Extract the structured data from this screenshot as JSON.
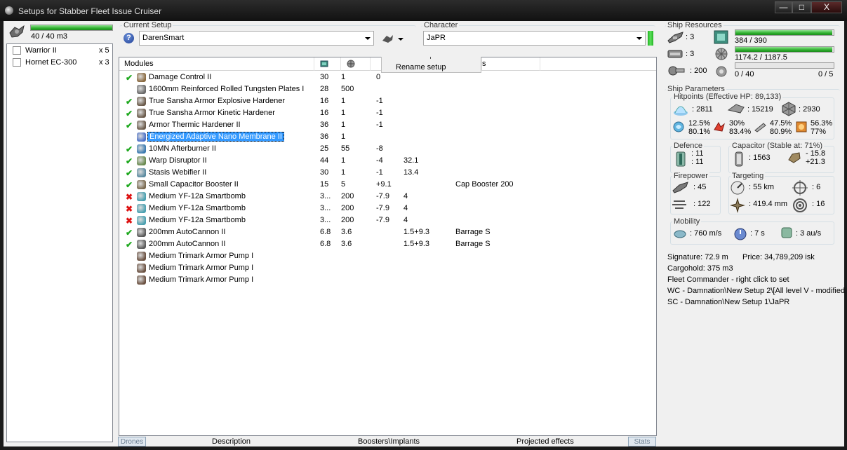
{
  "window": {
    "title": "Setups for Stabber Fleet Issue Cruiser",
    "minimize": "—",
    "maximize": "□",
    "close": "X"
  },
  "drone_bay": {
    "usage": "40 / 40 m3",
    "usage_fraction": 1.0,
    "drones": [
      {
        "name": "Warrior II",
        "count": "x 5"
      },
      {
        "name": "Hornet EC-300",
        "count": "x 3"
      }
    ]
  },
  "current_setup": {
    "label": "Current Setup",
    "value": "DarenSmart",
    "help": "?"
  },
  "character": {
    "label": "Character",
    "value": "JaPR"
  },
  "context_menu": {
    "rename": "Rename setup"
  },
  "modules": {
    "header": {
      "name": "Modules",
      "s_fragment": "s"
    },
    "rows": [
      {
        "status": "ok",
        "name": "Damage Control II",
        "cpu": "30",
        "pg": "1",
        "cap": "0",
        "c4": "",
        "charge": ""
      },
      {
        "status": "none",
        "name": "1600mm Reinforced Rolled Tungsten Plates I",
        "cpu": "28",
        "pg": "500",
        "cap": "",
        "c4": "",
        "charge": ""
      },
      {
        "status": "ok",
        "name": "True Sansha Armor Explosive Hardener",
        "cpu": "16",
        "pg": "1",
        "cap": "-1",
        "c4": "",
        "charge": ""
      },
      {
        "status": "ok",
        "name": "True Sansha Armor Kinetic Hardener",
        "cpu": "16",
        "pg": "1",
        "cap": "-1",
        "c4": "",
        "charge": ""
      },
      {
        "status": "ok",
        "name": "Armor Thermic Hardener II",
        "cpu": "36",
        "pg": "1",
        "cap": "-1",
        "c4": "",
        "charge": ""
      },
      {
        "status": "selected",
        "name": "Energized Adaptive Nano Membrane II",
        "cpu": "36",
        "pg": "1",
        "cap": "",
        "c4": "",
        "charge": ""
      },
      {
        "status": "ok",
        "name": "10MN Afterburner II",
        "cpu": "25",
        "pg": "55",
        "cap": "-8",
        "c4": "",
        "charge": ""
      },
      {
        "status": "ok",
        "name": "Warp Disruptor II",
        "cpu": "44",
        "pg": "1",
        "cap": "-4",
        "c4": "32.1",
        "charge": ""
      },
      {
        "status": "ok",
        "name": "Stasis Webifier II",
        "cpu": "30",
        "pg": "1",
        "cap": "-1",
        "c4": "13.4",
        "charge": ""
      },
      {
        "status": "ok",
        "name": "Small Capacitor Booster II",
        "cpu": "15",
        "pg": "5",
        "cap": "+9.1",
        "c4": "",
        "charge": "Cap Booster 200"
      },
      {
        "status": "off",
        "name": "Medium YF-12a Smartbomb",
        "cpu": "3...",
        "pg": "200",
        "cap": "-7.9",
        "c4": "4",
        "charge": ""
      },
      {
        "status": "off",
        "name": "Medium YF-12a Smartbomb",
        "cpu": "3...",
        "pg": "200",
        "cap": "-7.9",
        "c4": "4",
        "charge": ""
      },
      {
        "status": "off",
        "name": "Medium YF-12a Smartbomb",
        "cpu": "3...",
        "pg": "200",
        "cap": "-7.9",
        "c4": "4",
        "charge": ""
      },
      {
        "status": "ok",
        "name": "200mm AutoCannon II",
        "cpu": "6.8",
        "pg": "3.6",
        "cap": "",
        "c4": "1.5+9.3",
        "charge": "Barrage S"
      },
      {
        "status": "ok",
        "name": "200mm AutoCannon II",
        "cpu": "6.8",
        "pg": "3.6",
        "cap": "",
        "c4": "1.5+9.3",
        "charge": "Barrage S"
      },
      {
        "status": "none",
        "name": "Medium Trimark Armor Pump I",
        "cpu": "",
        "pg": "",
        "cap": "",
        "c4": "",
        "charge": ""
      },
      {
        "status": "none",
        "name": "Medium Trimark Armor Pump I",
        "cpu": "",
        "pg": "",
        "cap": "",
        "c4": "",
        "charge": ""
      },
      {
        "status": "none",
        "name": "Medium Trimark Armor Pump I",
        "cpu": "",
        "pg": "",
        "cap": "",
        "c4": "",
        "charge": ""
      }
    ]
  },
  "bottom_tabs": {
    "drones": "Drones",
    "description": "Description",
    "boosters": "Boosters\\Implants",
    "projected": "Projected effects",
    "stats": "Stats"
  },
  "ship_resources": {
    "label": "Ship Resources",
    "hardpoints_turret": ": 3",
    "hardpoints_launcher": ": 3",
    "calibration": ": 200",
    "cpu": "384 / 390",
    "cpu_fraction": 0.985,
    "powergrid": "1174.2 / 1187.5",
    "powergrid_fraction": 0.989,
    "drone_bandwidth": "0 / 40",
    "drone_bandwidth_fraction": 0.0,
    "drones_active": "0 / 5"
  },
  "ship_parameters": {
    "label": "Ship Parameters",
    "hitpoints": {
      "label": "Hitpoints (Effective HP: 89,133)",
      "shield": ": 2811",
      "armor": ": 15219",
      "structure": ": 2930",
      "res_em": [
        "12.5%",
        "80.1%"
      ],
      "res_thermal": [
        "30%",
        "83.4%"
      ],
      "res_kinetic": [
        "47.5%",
        "80.9%"
      ],
      "res_explosive": [
        "56.3%",
        "77%"
      ]
    },
    "defence": {
      "label": "Defence",
      "v1": ": 11",
      "v2": ": 11"
    },
    "capacitor": {
      "label": "Capacitor (Stable at: 71%)",
      "amount": ": 1563",
      "v1": "- 15.8",
      "v2": "+21.3"
    },
    "firepower": {
      "label": "Firepower",
      "v1": ": 45",
      "v2": ": 122"
    },
    "targeting": {
      "label": "Targeting",
      "range": ": 55 km",
      "targets": ": 6",
      "res": ": 419.4 mm",
      "sensor": ": 16"
    },
    "mobility": {
      "label": "Mobility",
      "speed": ": 760 m/s",
      "align": ": 7 s",
      "warp": ": 3 au/s"
    }
  },
  "summary": {
    "signature": "Signature: 72.9 m",
    "price": "Price: 34,789,209 isk",
    "cargohold": "Cargohold: 375 m3",
    "fleet": "Fleet Commander - right click to set",
    "wc": "WC - Damnation\\New Setup 2\\[All level V - modified",
    "sc": "SC - Damnation\\New Setup 1\\JaPR"
  },
  "colors": {
    "bar_green": "#2eb02e",
    "selection": "#3399ff",
    "check": "#1ea81e",
    "cross": "#dd1111"
  }
}
